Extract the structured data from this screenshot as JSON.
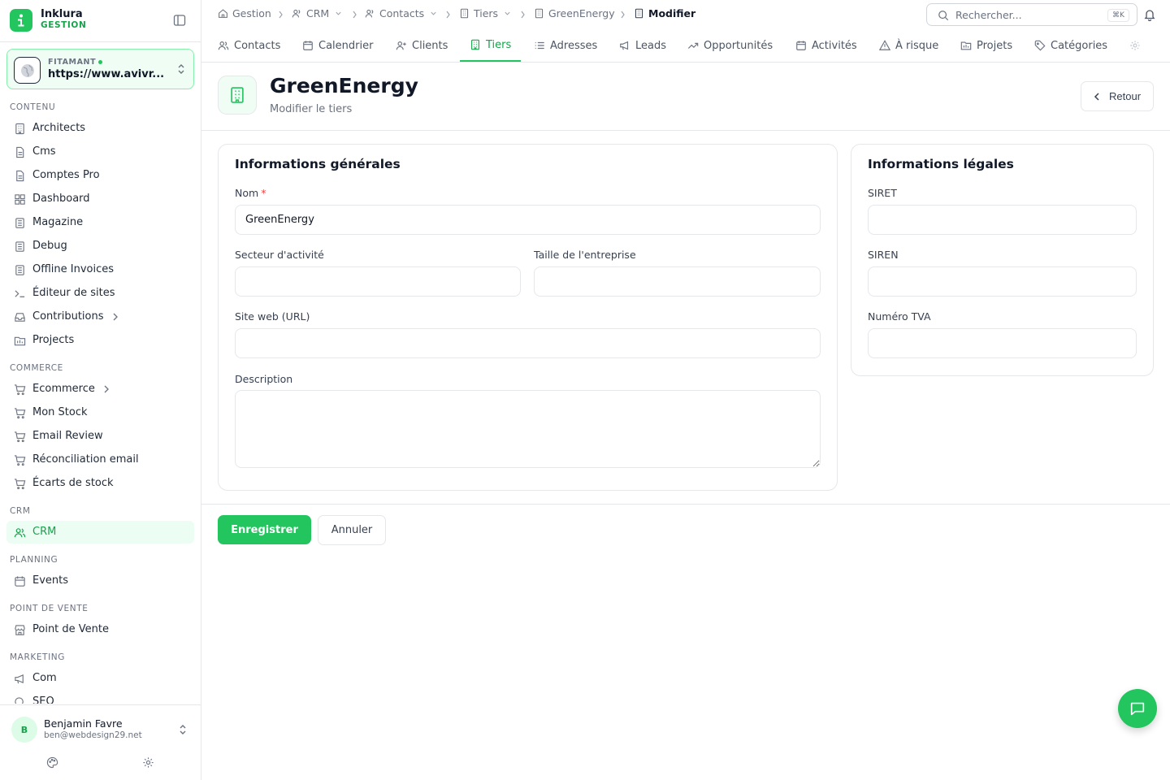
{
  "brand": {
    "name": "Inklura",
    "subtitle": "GESTION"
  },
  "site": {
    "label": "FITAMANT",
    "url": "https://www.avivr..."
  },
  "sidebar": {
    "sections": {
      "contenu": "CONTENU",
      "commerce": "COMMERCE",
      "crm": "CRM",
      "planning": "PLANNING",
      "pdv": "POINT DE VENTE",
      "marketing": "MARKETING"
    },
    "items": {
      "architects": "Architects",
      "cms": "Cms",
      "comptes_pro": "Comptes Pro",
      "dashboard": "Dashboard",
      "magazine": "Magazine",
      "debug": "Debug",
      "offline_invoices": "Offline Invoices",
      "editeur": "Éditeur de sites",
      "contributions": "Contributions",
      "projects": "Projects",
      "ecommerce": "Ecommerce",
      "mon_stock": "Mon Stock",
      "email_review": "Email Review",
      "reconciliation": "Réconciliation email",
      "ecarts": "Écarts de stock",
      "crm": "CRM",
      "events": "Events",
      "point_de_vente": "Point de Vente",
      "com": "Com",
      "seo": "SEO"
    }
  },
  "user": {
    "initial": "B",
    "name": "Benjamin Favre",
    "email": "ben@webdesign29.net"
  },
  "breadcrumb": {
    "gestion": "Gestion",
    "crm": "CRM",
    "contacts": "Contacts",
    "tiers": "Tiers",
    "greenenergy": "GreenEnergy",
    "modifier": "Modifier"
  },
  "search": {
    "placeholder": "Rechercher...",
    "shortcut": "⌘K"
  },
  "tabs": {
    "contacts": "Contacts",
    "calendrier": "Calendrier",
    "clients": "Clients",
    "tiers": "Tiers",
    "adresses": "Adresses",
    "leads": "Leads",
    "opportunites": "Opportunités",
    "activites": "Activités",
    "a_risque": "À risque",
    "projets": "Projets",
    "categories": "Catégories"
  },
  "header": {
    "title": "GreenEnergy",
    "subtitle": "Modifier le tiers",
    "back_label": "Retour"
  },
  "general": {
    "title": "Informations générales",
    "nom_label": "Nom",
    "nom_required": "*",
    "nom_value": "GreenEnergy",
    "secteur_label": "Secteur d'activité",
    "secteur_value": "",
    "taille_label": "Taille de l'entreprise",
    "taille_value": "",
    "site_label": "Site web (URL)",
    "site_value": "",
    "description_label": "Description",
    "description_value": ""
  },
  "legal": {
    "title": "Informations légales",
    "siret_label": "SIRET",
    "siret_value": "",
    "siren_label": "SIREN",
    "siren_value": "",
    "tva_label": "Numéro TVA",
    "tva_value": ""
  },
  "actions": {
    "save_label": "Enregistrer",
    "cancel_label": "Annuler"
  },
  "colors": {
    "accent": "#22c55e",
    "accent_text": "#16a34a",
    "active_bg": "#ecfdf3"
  },
  "icons": {
    "brand": "info-logo-icon",
    "site": "globe-icon",
    "chat": "chat-bubble-icon",
    "notifications": "bell-icon"
  }
}
